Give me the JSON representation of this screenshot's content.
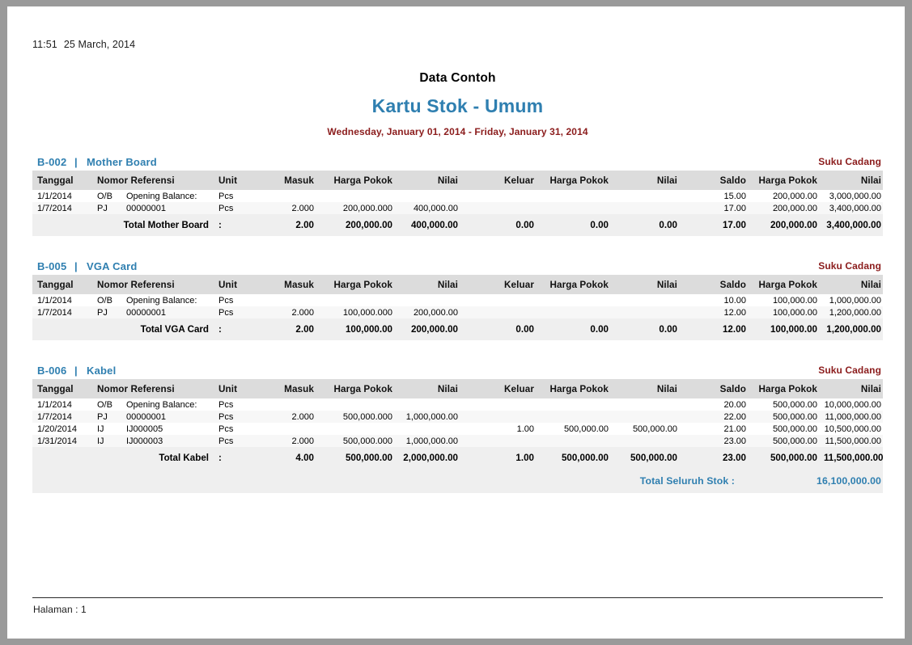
{
  "header": {
    "time": "11:51",
    "date": "25 March, 2014"
  },
  "title_block": {
    "company_name": "Data Contoh",
    "report_title": "Kartu Stok - Umum",
    "period": "Wednesday, January 01, 2014 - Friday, January 31, 2014"
  },
  "columns": {
    "tanggal": "Tanggal",
    "nomor_referensi": "Nomor Referensi",
    "unit": "Unit",
    "masuk": "Masuk",
    "masuk_harga_pokok": "Harga Pokok",
    "masuk_nilai": "Nilai",
    "keluar": "Keluar",
    "keluar_harga_pokok": "Harga Pokok",
    "keluar_nilai": "Nilai",
    "saldo": "Saldo",
    "saldo_harga_pokok": "Harga Pokok",
    "saldo_nilai": "Nilai"
  },
  "groups": [
    {
      "code": "B-002",
      "separator": "|",
      "name": "Mother Board",
      "category": "Suku Cadang",
      "rows": [
        {
          "tanggal": "1/1/2014",
          "ref_code": "O/B",
          "ref_no": "Opening Balance:",
          "unit": "Pcs",
          "masuk": "",
          "masuk_hp": "",
          "masuk_nilai": "",
          "keluar": "",
          "keluar_hp": "",
          "keluar_nilai": "",
          "saldo": "15.00",
          "saldo_hp": "200,000.00",
          "saldo_nilai": "3,000,000.00"
        },
        {
          "tanggal": "1/7/2014",
          "ref_code": "PJ",
          "ref_no": "00000001",
          "unit": "Pcs",
          "masuk": "2.000",
          "masuk_hp": "200,000.000",
          "masuk_nilai": "400,000.00",
          "keluar": "",
          "keluar_hp": "",
          "keluar_nilai": "",
          "saldo": "17.00",
          "saldo_hp": "200,000.00",
          "saldo_nilai": "3,400,000.00"
        }
      ],
      "total": {
        "label": "Total Mother Board",
        "colon": ":",
        "masuk": "2.00",
        "masuk_hp": "200,000.00",
        "masuk_nilai": "400,000.00",
        "keluar": "0.00",
        "keluar_hp": "0.00",
        "keluar_nilai": "0.00",
        "saldo": "17.00",
        "saldo_hp": "200,000.00",
        "saldo_nilai": "3,400,000.00"
      }
    },
    {
      "code": "B-005",
      "separator": "|",
      "name": "VGA Card",
      "category": "Suku Cadang",
      "rows": [
        {
          "tanggal": "1/1/2014",
          "ref_code": "O/B",
          "ref_no": "Opening Balance:",
          "unit": "Pcs",
          "masuk": "",
          "masuk_hp": "",
          "masuk_nilai": "",
          "keluar": "",
          "keluar_hp": "",
          "keluar_nilai": "",
          "saldo": "10.00",
          "saldo_hp": "100,000.00",
          "saldo_nilai": "1,000,000.00"
        },
        {
          "tanggal": "1/7/2014",
          "ref_code": "PJ",
          "ref_no": "00000001",
          "unit": "Pcs",
          "masuk": "2.000",
          "masuk_hp": "100,000.000",
          "masuk_nilai": "200,000.00",
          "keluar": "",
          "keluar_hp": "",
          "keluar_nilai": "",
          "saldo": "12.00",
          "saldo_hp": "100,000.00",
          "saldo_nilai": "1,200,000.00"
        }
      ],
      "total": {
        "label": "Total VGA Card",
        "colon": ":",
        "masuk": "2.00",
        "masuk_hp": "100,000.00",
        "masuk_nilai": "200,000.00",
        "keluar": "0.00",
        "keluar_hp": "0.00",
        "keluar_nilai": "0.00",
        "saldo": "12.00",
        "saldo_hp": "100,000.00",
        "saldo_nilai": "1,200,000.00"
      }
    },
    {
      "code": "B-006",
      "separator": "|",
      "name": "Kabel",
      "category": "Suku Cadang",
      "rows": [
        {
          "tanggal": "1/1/2014",
          "ref_code": "O/B",
          "ref_no": "Opening Balance:",
          "unit": "Pcs",
          "masuk": "",
          "masuk_hp": "",
          "masuk_nilai": "",
          "keluar": "",
          "keluar_hp": "",
          "keluar_nilai": "",
          "saldo": "20.00",
          "saldo_hp": "500,000.00",
          "saldo_nilai": "10,000,000.00"
        },
        {
          "tanggal": "1/7/2014",
          "ref_code": "PJ",
          "ref_no": "00000001",
          "unit": "Pcs",
          "masuk": "2.000",
          "masuk_hp": "500,000.000",
          "masuk_nilai": "1,000,000.00",
          "keluar": "",
          "keluar_hp": "",
          "keluar_nilai": "",
          "saldo": "22.00",
          "saldo_hp": "500,000.00",
          "saldo_nilai": "11,000,000.00"
        },
        {
          "tanggal": "1/20/2014",
          "ref_code": "IJ",
          "ref_no": "IJ000005",
          "unit": "Pcs",
          "masuk": "",
          "masuk_hp": "",
          "masuk_nilai": "",
          "keluar": "1.00",
          "keluar_hp": "500,000.00",
          "keluar_nilai": "500,000.00",
          "saldo": "21.00",
          "saldo_hp": "500,000.00",
          "saldo_nilai": "10,500,000.00"
        },
        {
          "tanggal": "1/31/2014",
          "ref_code": "IJ",
          "ref_no": "IJ000003",
          "unit": "Pcs",
          "masuk": "2.000",
          "masuk_hp": "500,000.000",
          "masuk_nilai": "1,000,000.00",
          "keluar": "",
          "keluar_hp": "",
          "keluar_nilai": "",
          "saldo": "23.00",
          "saldo_hp": "500,000.00",
          "saldo_nilai": "11,500,000.00"
        }
      ],
      "total": {
        "label": "Total Kabel",
        "colon": ":",
        "masuk": "4.00",
        "masuk_hp": "500,000.00",
        "masuk_nilai": "2,000,000.00",
        "keluar": "1.00",
        "keluar_hp": "500,000.00",
        "keluar_nilai": "500,000.00",
        "saldo": "23.00",
        "saldo_hp": "500,000.00",
        "saldo_nilai": "11,500,000.00"
      }
    }
  ],
  "grand_total": {
    "label": "Total Seluruh Stok :",
    "value": "16,100,000.00"
  },
  "footer": {
    "page_label": "Halaman : 1"
  },
  "colors": {
    "title_blue": "#2f7fb0",
    "category_red": "#8b1c1c",
    "header_band": "#dcdcdc",
    "total_band": "#efefef",
    "page_background": "#ffffff",
    "canvas_gray": "#9a9a9a"
  }
}
